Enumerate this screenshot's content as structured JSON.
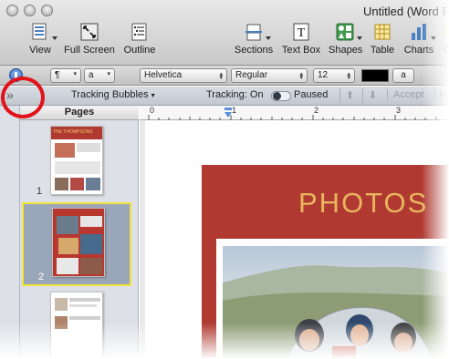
{
  "window": {
    "title": "Untitled (Word F"
  },
  "toolbar": {
    "items": [
      {
        "label": "View",
        "icon": "view-icon"
      },
      {
        "label": "Full Screen",
        "icon": "full-screen-icon"
      },
      {
        "label": "Outline",
        "icon": "outline-icon"
      },
      {
        "label": "Sections",
        "icon": "sections-icon"
      },
      {
        "label": "Text Box",
        "icon": "text-box-icon"
      },
      {
        "label": "Shapes",
        "icon": "shapes-icon"
      },
      {
        "label": "Table",
        "icon": "table-icon"
      },
      {
        "label": "Charts",
        "icon": "charts-icon"
      },
      {
        "label": "C",
        "icon": "comment-icon"
      }
    ]
  },
  "format_bar": {
    "paragraph_symbol": "¶",
    "char_style": "a",
    "font": "Helvetica",
    "style": "Regular",
    "size": "12",
    "char_sample": "a"
  },
  "tracking_bar": {
    "toggle_glyph": "»",
    "bubbles_label": "Tracking Bubbles",
    "tracking_label": "Tracking: On",
    "paused_label": "Paused",
    "accept_label": "Accept",
    "reject_label": "Re"
  },
  "sidebar": {
    "header": "Pages",
    "pages": [
      {
        "number": "1",
        "thumb_title": "THE THOMPSONS"
      },
      {
        "number": "2",
        "thumb_title": ""
      },
      {
        "number": "",
        "thumb_title": ""
      }
    ]
  },
  "ruler": {
    "marks": [
      "0",
      "1",
      "2",
      "3"
    ]
  },
  "document": {
    "heading": "PHOTOS"
  },
  "colors": {
    "accent_red": "#b03a32",
    "heading_gold": "#e9b55d",
    "selection_yellow": "#f1e339",
    "callout_red": "#e2131b"
  }
}
